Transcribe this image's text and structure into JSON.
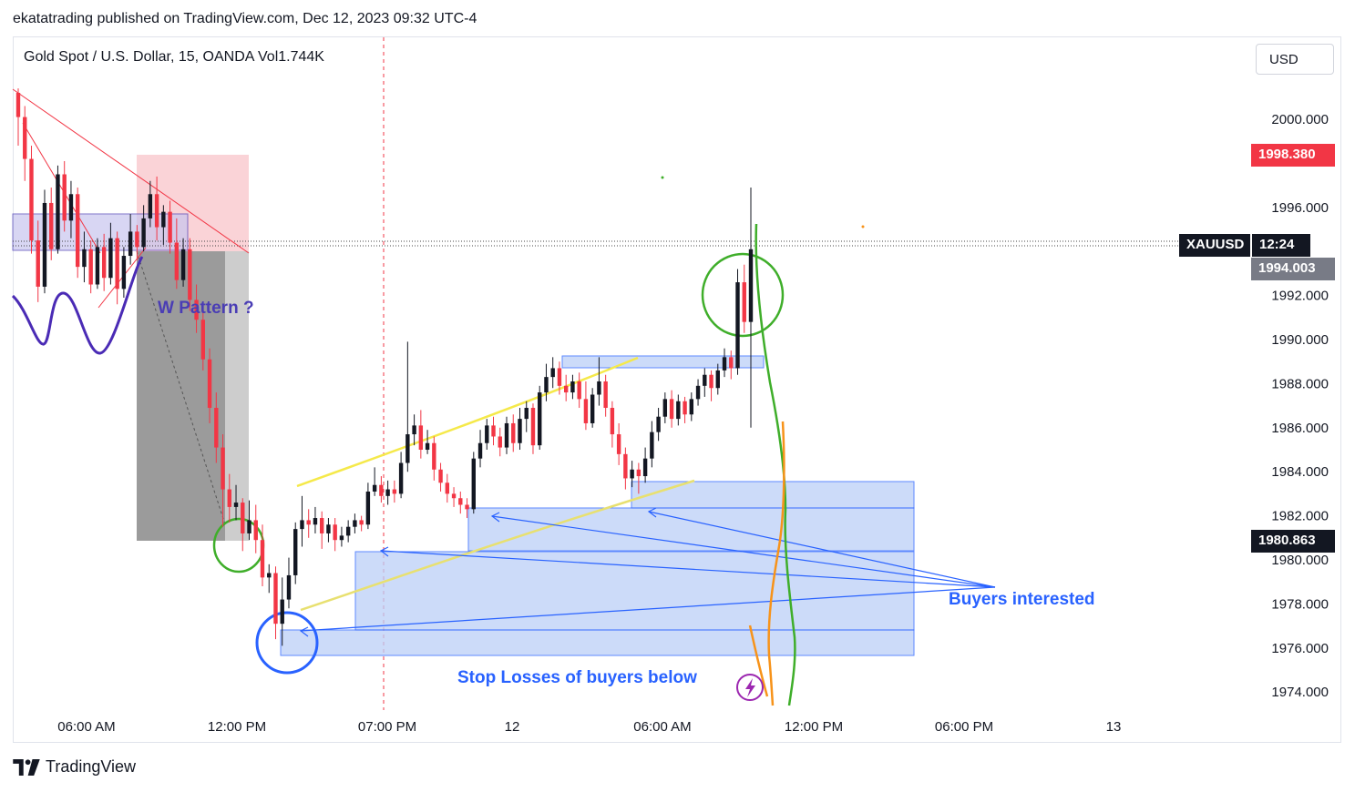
{
  "header": {
    "published": "ekatatrading published on TradingView.com, Dec 12, 2023 09:32 UTC-4"
  },
  "symbol_line": "Gold Spot / U.S. Dollar, 15, OANDA  Vol1.744K",
  "currency": "USD",
  "footer": {
    "brand": "TradingView"
  },
  "price_tags": {
    "red": "1998.380",
    "symbol": "XAUUSD",
    "countdown": "12:24",
    "gray": "1994.003",
    "black": "1980.863"
  },
  "annotations": {
    "w_pattern": "W Pattern ?",
    "buyers": "Buyers interested",
    "stops": "Stop Losses of buyers below"
  },
  "colors": {
    "up": "#131722",
    "down": "#f23645",
    "zone_fill": "#bcd0f7",
    "zone_stroke": "#2962ff",
    "red_tag": "#f23645",
    "gray_tag": "#787b86"
  },
  "chart_data": {
    "type": "candlestick",
    "y_ticks": [
      "2000.000",
      "1996.000",
      "1992.000",
      "1990.000",
      "1988.000",
      "1986.000",
      "1984.000",
      "1982.000",
      "1980.000",
      "1978.000",
      "1976.000",
      "1974.000"
    ],
    "x_ticks": [
      "06:00 AM",
      "12:00 PM",
      "07:00 PM",
      "12",
      "06:00 AM",
      "12:00 PM",
      "06:00 PM",
      "13"
    ],
    "ylim": [
      1973.5,
      2002.5
    ],
    "candles": [
      [
        2001.2,
        2000.1,
        2001.4,
        1998.8
      ],
      [
        2000.1,
        1998.2,
        2000.6,
        1997.2
      ],
      [
        1998.2,
        1994.5,
        1998.8,
        1993.9
      ],
      [
        1994.5,
        1992.4,
        1995.4,
        1991.7
      ],
      [
        1992.4,
        1996.2,
        1996.8,
        1992.1
      ],
      [
        1996.2,
        1994.1,
        1996.9,
        1993.6
      ],
      [
        1994.1,
        1997.5,
        1997.9,
        1993.9
      ],
      [
        1997.5,
        1995.4,
        1998.1,
        1994.9
      ],
      [
        1995.4,
        1996.6,
        1997.2,
        1994.6
      ],
      [
        1996.6,
        1993.3,
        1996.9,
        1992.8
      ],
      [
        1993.3,
        1994.1,
        1994.9,
        1992.6
      ],
      [
        1994.1,
        1992.5,
        1994.5,
        1992.1
      ],
      [
        1992.5,
        1994.2,
        1994.6,
        1992.3
      ],
      [
        1994.2,
        1992.8,
        1994.8,
        1992.2
      ],
      [
        1992.8,
        1994.6,
        1995.3,
        1992.5
      ],
      [
        1994.6,
        1992.3,
        1994.9,
        1991.6
      ],
      [
        1992.3,
        1993.8,
        1994.2,
        1991.9
      ],
      [
        1993.8,
        1994.9,
        1995.7,
        1993.4
      ],
      [
        1994.9,
        1994.2,
        1995.2,
        1993.6
      ],
      [
        1994.2,
        1995.5,
        1996.1,
        1994.0
      ],
      [
        1995.5,
        1996.6,
        1997.2,
        1995.1
      ],
      [
        1996.6,
        1995.1,
        1997.4,
        1994.5
      ],
      [
        1995.1,
        1995.8,
        1996.1,
        1994.3
      ],
      [
        1995.8,
        1994.4,
        1996.3,
        1993.9
      ],
      [
        1994.4,
        1992.7,
        1995.5,
        1992.3
      ],
      [
        1992.7,
        1994.1,
        1994.6,
        1992.4
      ],
      [
        1994.1,
        1991.8,
        1994.6,
        1991.3
      ],
      [
        1991.8,
        1990.9,
        1992.5,
        1990.3
      ],
      [
        1990.9,
        1989.1,
        1991.5,
        1988.6
      ],
      [
        1989.1,
        1986.9,
        1989.6,
        1986.2
      ],
      [
        1986.9,
        1985.1,
        1987.6,
        1984.4
      ],
      [
        1985.1,
        1983.2,
        1985.7,
        1981.5
      ],
      [
        1983.2,
        1982.4,
        1983.9,
        1981.7
      ],
      [
        1982.4,
        1982.6,
        1983.4,
        1981.8
      ],
      [
        1982.6,
        1981.2,
        1982.8,
        1980.4
      ],
      [
        1981.2,
        1981.8,
        1982.7,
        1980.9
      ],
      [
        1981.8,
        1980.9,
        1982.5,
        1980.3
      ],
      [
        1980.9,
        1979.2,
        1981.6,
        1978.8
      ],
      [
        1979.2,
        1979.4,
        1979.8,
        1978.5
      ],
      [
        1979.4,
        1977.1,
        1979.7,
        1976.4
      ],
      [
        1977.1,
        1978.2,
        1979.2,
        1976.1
      ],
      [
        1978.2,
        1979.3,
        1980.1,
        1977.8
      ],
      [
        1979.3,
        1981.4,
        1981.7,
        1978.9
      ],
      [
        1981.4,
        1981.8,
        1982.9,
        1980.6
      ],
      [
        1981.8,
        1981.6,
        1982.3,
        1981.0
      ],
      [
        1981.6,
        1981.9,
        1982.4,
        1981.2
      ],
      [
        1981.9,
        1981.2,
        1982.2,
        1980.5
      ],
      [
        1981.2,
        1981.6,
        1981.9,
        1980.8
      ],
      [
        1981.6,
        1980.9,
        1981.9,
        1980.4
      ],
      [
        1980.9,
        1981.1,
        1981.5,
        1980.6
      ],
      [
        1981.1,
        1981.5,
        1981.8,
        1980.8
      ],
      [
        1981.5,
        1981.8,
        1982.1,
        1981.2
      ],
      [
        1981.8,
        1981.6,
        1982.0,
        1981.3
      ],
      [
        1981.6,
        1983.1,
        1983.5,
        1981.4
      ],
      [
        1983.1,
        1983.4,
        1984.2,
        1982.9
      ],
      [
        1983.4,
        1982.9,
        1983.8,
        1982.6
      ],
      [
        1982.9,
        1983.2,
        1983.6,
        1982.5
      ],
      [
        1983.2,
        1983.0,
        1983.6,
        1982.6
      ],
      [
        1983.0,
        1984.4,
        1984.9,
        1982.8
      ],
      [
        1984.4,
        1985.7,
        1989.9,
        1984.0
      ],
      [
        1985.7,
        1986.1,
        1986.6,
        1985.2
      ],
      [
        1986.1,
        1985.0,
        1986.8,
        1984.6
      ],
      [
        1985.0,
        1985.3,
        1985.9,
        1984.8
      ],
      [
        1985.3,
        1984.1,
        1985.6,
        1983.6
      ],
      [
        1984.1,
        1983.5,
        1984.4,
        1983.1
      ],
      [
        1983.5,
        1983.0,
        1983.9,
        1982.6
      ],
      [
        1983.0,
        1982.8,
        1983.3,
        1982.4
      ],
      [
        1982.8,
        1982.5,
        1983.1,
        1982.1
      ],
      [
        1982.5,
        1982.3,
        1982.8,
        1981.9
      ],
      [
        1982.3,
        1984.6,
        1984.9,
        1982.1
      ],
      [
        1984.6,
        1985.3,
        1985.9,
        1984.2
      ],
      [
        1985.3,
        1986.1,
        1986.4,
        1985.0
      ],
      [
        1986.1,
        1985.6,
        1986.5,
        1985.2
      ],
      [
        1985.6,
        1985.1,
        1986.0,
        1984.7
      ],
      [
        1985.1,
        1986.2,
        1986.5,
        1984.8
      ],
      [
        1986.2,
        1985.3,
        1986.6,
        1984.9
      ],
      [
        1985.3,
        1986.4,
        1986.9,
        1985.0
      ],
      [
        1986.4,
        1986.9,
        1987.2,
        1985.8
      ],
      [
        1986.9,
        1985.2,
        1987.1,
        1984.8
      ],
      [
        1985.2,
        1987.6,
        1987.9,
        1985.0
      ],
      [
        1987.6,
        1988.3,
        1988.9,
        1987.2
      ],
      [
        1988.3,
        1988.7,
        1989.2,
        1987.8
      ],
      [
        1988.7,
        1987.9,
        1989.0,
        1987.5
      ],
      [
        1987.9,
        1987.6,
        1988.4,
        1987.2
      ],
      [
        1987.6,
        1988.1,
        1988.4,
        1987.3
      ],
      [
        1988.1,
        1987.3,
        1988.5,
        1986.9
      ],
      [
        1987.3,
        1986.2,
        1988.1,
        1985.9
      ],
      [
        1986.2,
        1987.5,
        1987.8,
        1986.0
      ],
      [
        1987.5,
        1988.1,
        1989.2,
        1987.0
      ],
      [
        1988.1,
        1986.9,
        1988.4,
        1986.5
      ],
      [
        1986.9,
        1985.7,
        1987.2,
        1985.1
      ],
      [
        1985.7,
        1984.8,
        1986.2,
        1984.3
      ],
      [
        1984.8,
        1983.7,
        1985.1,
        1983.2
      ],
      [
        1983.7,
        1984.1,
        1984.5,
        1983.3
      ],
      [
        1984.1,
        1983.8,
        1984.4,
        1983.0
      ],
      [
        1983.8,
        1984.6,
        1985.1,
        1983.5
      ],
      [
        1984.6,
        1985.8,
        1986.3,
        1984.2
      ],
      [
        1985.8,
        1986.5,
        1986.9,
        1985.4
      ],
      [
        1986.5,
        1987.3,
        1987.6,
        1986.2
      ],
      [
        1987.3,
        1986.4,
        1987.7,
        1986.0
      ],
      [
        1986.4,
        1987.2,
        1987.5,
        1986.1
      ],
      [
        1987.2,
        1986.6,
        1987.4,
        1986.2
      ],
      [
        1986.6,
        1987.3,
        1987.6,
        1986.3
      ],
      [
        1987.3,
        1987.9,
        1988.2,
        1987.0
      ],
      [
        1987.9,
        1988.4,
        1988.7,
        1987.4
      ],
      [
        1988.4,
        1987.8,
        1988.6,
        1987.2
      ],
      [
        1987.8,
        1988.6,
        1988.9,
        1987.5
      ],
      [
        1988.6,
        1989.2,
        1989.6,
        1988.3
      ],
      [
        1989.2,
        1988.7,
        1989.5,
        1988.2
      ],
      [
        1988.7,
        1992.6,
        1993.2,
        1988.4
      ],
      [
        1992.6,
        1990.8,
        1993.4,
        1990.3
      ],
      [
        1990.8,
        1994.1,
        1996.9,
        1986.0
      ]
    ]
  }
}
